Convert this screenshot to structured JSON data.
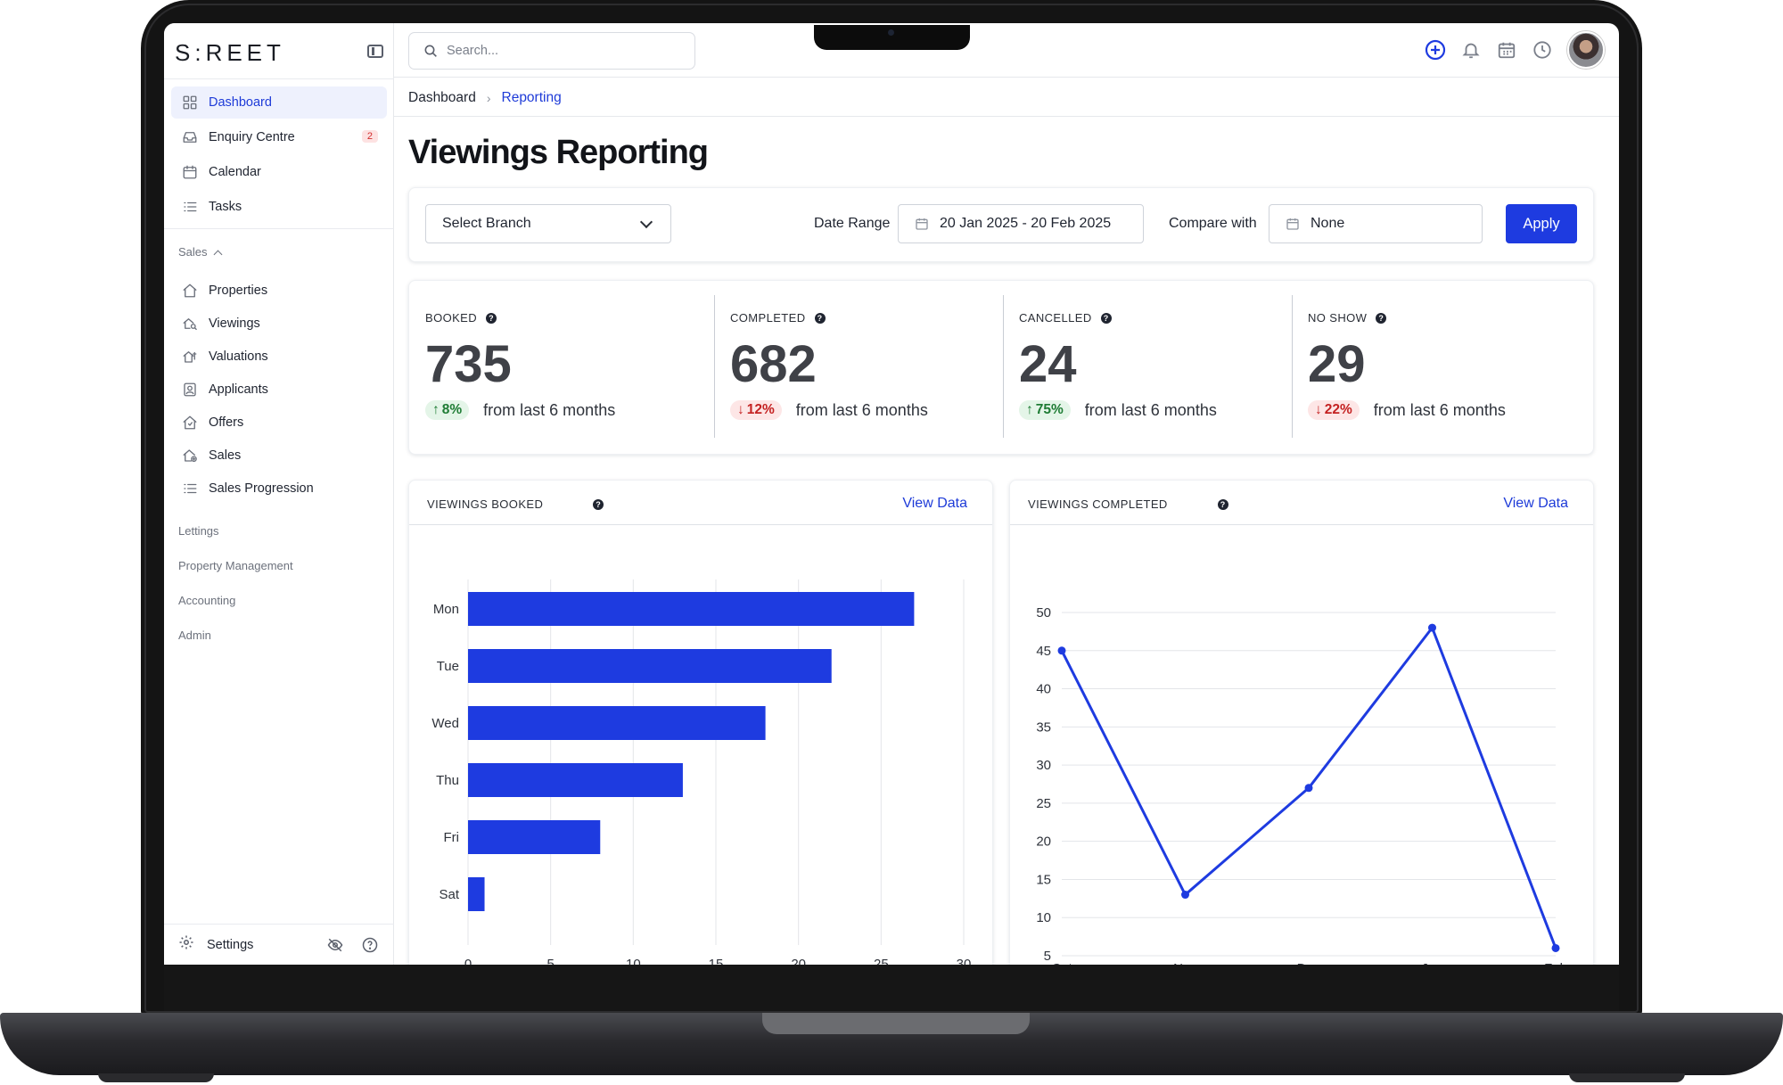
{
  "app": {
    "logo": "S:REET"
  },
  "sidebar": {
    "main_items": [
      {
        "label": "Dashboard",
        "icon": "grid-icon",
        "active": true
      },
      {
        "label": "Enquiry Centre",
        "icon": "inbox-icon",
        "badge": "2"
      },
      {
        "label": "Calendar",
        "icon": "calendar-icon"
      },
      {
        "label": "Tasks",
        "icon": "list-icon"
      }
    ],
    "sales_section": "Sales",
    "sales_items": [
      {
        "label": "Properties",
        "icon": "home-icon"
      },
      {
        "label": "Viewings",
        "icon": "viewing-icon"
      },
      {
        "label": "Valuations",
        "icon": "valuation-icon"
      },
      {
        "label": "Applicants",
        "icon": "contact-card-icon"
      },
      {
        "label": "Offers",
        "icon": "offer-icon"
      },
      {
        "label": "Sales",
        "icon": "sale-icon"
      },
      {
        "label": "Sales Progression",
        "icon": "list-icon"
      }
    ],
    "sections": [
      "Lettings",
      "Property Management",
      "Accounting",
      "Admin"
    ],
    "footer": {
      "settings_label": "Settings"
    }
  },
  "topbar": {
    "search_placeholder": "Search...",
    "icons": [
      "add-circle-icon",
      "bell-icon",
      "calendar-icon",
      "clock-icon"
    ]
  },
  "breadcrumb": {
    "home": "Dashboard",
    "current": "Reporting"
  },
  "page_title": "Viewings Reporting",
  "filters": {
    "branch_select": "Select Branch",
    "date_range_label": "Date Range",
    "date_range_value": "20 Jan 2025 - 20 Feb 2025",
    "compare_label": "Compare with",
    "compare_value": "None",
    "apply_label": "Apply"
  },
  "stats": [
    {
      "label": "BOOKED",
      "value": "735",
      "change": "8%",
      "direction": "up",
      "period": "from last 6 months"
    },
    {
      "label": "COMPLETED",
      "value": "682",
      "change": "12%",
      "direction": "down",
      "period": "from last 6 months"
    },
    {
      "label": "CANCELLED",
      "value": "24",
      "change": "75%",
      "direction": "up",
      "period": "from last 6 months"
    },
    {
      "label": "NO SHOW",
      "value": "29",
      "change": "22%",
      "direction": "down",
      "period": "from last 6 months"
    }
  ],
  "charts": {
    "booked": {
      "title": "VIEWINGS BOOKED",
      "link": "View Data"
    },
    "completed": {
      "title": "VIEWINGS COMPLETED",
      "link": "View Data"
    }
  },
  "colors": {
    "accent": "#1e3be0",
    "up": "#1e7c34",
    "down": "#c42222"
  },
  "chart_data": [
    {
      "type": "bar",
      "orientation": "horizontal",
      "title": "VIEWINGS BOOKED",
      "categories": [
        "Mon",
        "Tue",
        "Wed",
        "Thu",
        "Fri",
        "Sat"
      ],
      "values": [
        27,
        22,
        18,
        13,
        8,
        1
      ],
      "xlim": [
        0,
        30
      ],
      "xticks": [
        0,
        5,
        10,
        15,
        20,
        25,
        30
      ],
      "grid": true,
      "color": "#1e3be0"
    },
    {
      "type": "line",
      "title": "VIEWINGS COMPLETED",
      "x": [
        "Oct",
        "Nov",
        "Dec",
        "Jan",
        "Feb"
      ],
      "values": [
        45,
        13,
        27,
        48,
        6
      ],
      "ylim": [
        5,
        50
      ],
      "yticks": [
        5,
        10,
        15,
        20,
        25,
        30,
        35,
        40,
        45,
        50
      ],
      "grid": true,
      "color": "#1e3be0"
    }
  ]
}
